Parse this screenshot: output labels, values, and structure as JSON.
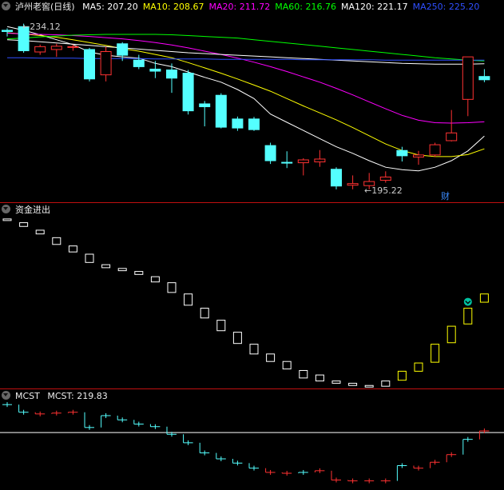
{
  "price_panel": {
    "stock_title": "泸州老窖(日线)",
    "ma_labels": [
      {
        "text": "MA5: 207.20",
        "color": "#ffffff"
      },
      {
        "text": "MA10: 208.67",
        "color": "#ffff00"
      },
      {
        "text": "MA20: 211.72",
        "color": "#ff00ff"
      },
      {
        "text": "MA60: 216.76",
        "color": "#00ff00"
      },
      {
        "text": "MA120: 221.17",
        "color": "#ffffff"
      },
      {
        "text": "MA250: 225.20",
        "color": "#2f4fff"
      }
    ],
    "high_marker": "234.12",
    "low_marker": "195.22",
    "event_badge": "财"
  },
  "fund_panel": {
    "title": "资金进出"
  },
  "mcst_panel": {
    "title": "MCST",
    "value_label": "MCST: 219.83"
  },
  "colors": {
    "up": "#ff3232",
    "down": "#54ffff",
    "separator": "#c01010"
  },
  "chart_data": [
    {
      "type": "candlestick",
      "title": "泸州老窖(日线)",
      "x": [
        1,
        2,
        3,
        4,
        5,
        6,
        7,
        8,
        9,
        10,
        11,
        12,
        13,
        14,
        15,
        16,
        17,
        18,
        19,
        20,
        21,
        22,
        23,
        24,
        25,
        26,
        27,
        28,
        29,
        30
      ],
      "ylim": [
        192,
        236
      ],
      "candles": [
        {
          "o": 232.5,
          "h": 233.0,
          "l": 231.0,
          "c": 232.2
        },
        {
          "o": 233.4,
          "h": 234.12,
          "l": 227.0,
          "c": 227.5
        },
        {
          "o": 227.2,
          "h": 229.0,
          "l": 226.5,
          "c": 228.5
        },
        {
          "o": 227.8,
          "h": 229.2,
          "l": 226.0,
          "c": 228.6
        },
        {
          "o": 228.4,
          "h": 229.0,
          "l": 227.5,
          "c": 228.5
        },
        {
          "o": 227.8,
          "h": 228.2,
          "l": 220.0,
          "c": 220.6
        },
        {
          "o": 221.6,
          "h": 228.5,
          "l": 220.0,
          "c": 227.3
        },
        {
          "o": 229.2,
          "h": 229.6,
          "l": 225.0,
          "c": 226.4
        },
        {
          "o": 225.2,
          "h": 226.5,
          "l": 223.0,
          "c": 223.6
        },
        {
          "o": 223.0,
          "h": 225.0,
          "l": 220.8,
          "c": 222.5
        },
        {
          "o": 222.8,
          "h": 224.4,
          "l": 217.2,
          "c": 220.8
        },
        {
          "o": 222.0,
          "h": 222.8,
          "l": 211.9,
          "c": 212.8
        },
        {
          "o": 214.5,
          "h": 215.2,
          "l": 209.0,
          "c": 213.8
        },
        {
          "o": 216.6,
          "h": 217.1,
          "l": 208.5,
          "c": 208.8
        },
        {
          "o": 210.8,
          "h": 211.4,
          "l": 207.9,
          "c": 208.6
        },
        {
          "o": 210.8,
          "h": 211.3,
          "l": 207.9,
          "c": 208.2
        },
        {
          "o": 204.3,
          "h": 205.0,
          "l": 199.8,
          "c": 200.6
        },
        {
          "o": 200.2,
          "h": 202.9,
          "l": 198.8,
          "c": 200.0
        },
        {
          "o": 200.1,
          "h": 201.2,
          "l": 197.0,
          "c": 200.8
        },
        {
          "o": 200.3,
          "h": 203.2,
          "l": 199.1,
          "c": 201.0
        },
        {
          "o": 198.5,
          "h": 199.0,
          "l": 193.6,
          "c": 194.4
        },
        {
          "o": 194.6,
          "h": 197.0,
          "l": 193.6,
          "c": 195.0
        },
        {
          "o": 194.5,
          "h": 197.6,
          "l": 193.6,
          "c": 195.5
        },
        {
          "o": 195.8,
          "h": 198.0,
          "l": 195.22,
          "c": 196.6
        },
        {
          "o": 203.1,
          "h": 204.0,
          "l": 200.4,
          "c": 201.8
        },
        {
          "o": 201.5,
          "h": 203.0,
          "l": 199.6,
          "c": 202.0
        },
        {
          "o": 202.0,
          "h": 205.0,
          "l": 201.5,
          "c": 204.5
        },
        {
          "o": 205.5,
          "h": 213.0,
          "l": 205.3,
          "c": 207.4
        },
        {
          "o": 215.6,
          "h": 226.0,
          "l": 211.5,
          "c": 226.0
        },
        {
          "o": 221.2,
          "h": 223.0,
          "l": 219.8,
          "c": 220.4
        }
      ],
      "ma": [
        {
          "name": "MA5",
          "color": "#ffffff",
          "values": [
            233.4,
            232.5,
            231.4,
            230.2,
            229.0,
            227.2,
            226.4,
            226.0,
            225.7,
            224.4,
            223.6,
            222.3,
            221.0,
            219.8,
            218.0,
            215.8,
            212.0,
            210.0,
            208.0,
            206.0,
            204.0,
            202.4,
            200.6,
            199.0,
            198.4,
            198.1,
            199.0,
            200.6,
            203.0,
            206.6
          ]
        },
        {
          "name": "MA10",
          "color": "#ffff00",
          "values": [
            231.9,
            231.6,
            231.2,
            230.8,
            230.2,
            229.5,
            228.8,
            228.0,
            227.4,
            226.6,
            225.8,
            224.6,
            223.3,
            222.0,
            220.6,
            219.1,
            217.6,
            215.8,
            214.0,
            212.3,
            210.6,
            208.7,
            206.7,
            204.7,
            203.1,
            202.0,
            201.6,
            201.6,
            202.1,
            203.5
          ]
        },
        {
          "name": "MA20",
          "color": "#ff00ff",
          "values": [
            231.8,
            231.6,
            231.5,
            231.4,
            231.2,
            231.0,
            230.7,
            230.4,
            230.0,
            229.5,
            228.9,
            228.2,
            227.4,
            226.6,
            225.7,
            224.7,
            223.6,
            222.4,
            221.1,
            219.8,
            218.3,
            216.7,
            215.0,
            213.3,
            211.7,
            210.5,
            209.9,
            209.8,
            209.9,
            210.1
          ]
        },
        {
          "name": "MA60",
          "color": "#00ff00",
          "values": [
            230.4,
            230.6,
            230.9,
            231.1,
            231.3,
            231.4,
            231.5,
            231.5,
            231.5,
            231.5,
            231.4,
            231.2,
            231.0,
            230.8,
            230.6,
            230.2,
            229.8,
            229.4,
            229.0,
            228.6,
            228.2,
            227.8,
            227.4,
            227.0,
            226.6,
            226.2,
            225.8,
            225.5,
            225.2,
            225.0
          ]
        },
        {
          "name": "MA120",
          "color": "#ffffff",
          "values": [
            230.2,
            230.0,
            229.7,
            229.4,
            229.1,
            228.8,
            228.5,
            228.2,
            227.9,
            227.6,
            227.3,
            227.0,
            226.8,
            226.6,
            226.4,
            226.2,
            226.0,
            225.8,
            225.6,
            225.4,
            225.2,
            225.0,
            224.8,
            224.6,
            224.4,
            224.3,
            224.2,
            224.2,
            224.2,
            224.3
          ]
        },
        {
          "name": "MA250",
          "color": "#2f4fff",
          "values": [
            225.8,
            225.8,
            225.7,
            225.7,
            225.7,
            225.6,
            225.6,
            225.6,
            225.6,
            225.5,
            225.5,
            225.5,
            225.5,
            225.4,
            225.4,
            225.4,
            225.4,
            225.4,
            225.3,
            225.3,
            225.3,
            225.3,
            225.3,
            225.2,
            225.2,
            225.2,
            225.2,
            225.2,
            225.2,
            225.2
          ]
        }
      ]
    },
    {
      "type": "bar",
      "title": "资金进出",
      "x": [
        1,
        2,
        3,
        4,
        5,
        6,
        7,
        8,
        9,
        10,
        11,
        12,
        13,
        14,
        15,
        16,
        17,
        18,
        19,
        20,
        21,
        22,
        23,
        24,
        25,
        26,
        27,
        28,
        29,
        30
      ],
      "ylim": [
        0,
        100
      ],
      "bars": [
        {
          "o": 99.0,
          "c": 98.0
        },
        {
          "o": 96.5,
          "c": 94.0
        },
        {
          "o": 91.5,
          "c": 89.0
        },
        {
          "o": 86.5,
          "c": 82.0
        },
        {
          "o": 81.0,
          "c": 77.0
        },
        {
          "o": 75.5,
          "c": 70.0
        },
        {
          "o": 68.5,
          "c": 66.5
        },
        {
          "o": 66.0,
          "c": 64.5
        },
        {
          "o": 64.0,
          "c": 62.0
        },
        {
          "o": 60.5,
          "c": 57.0
        },
        {
          "o": 56.5,
          "c": 50.0
        },
        {
          "o": 49.0,
          "c": 41.5
        },
        {
          "o": 39.5,
          "c": 33.0
        },
        {
          "o": 31.5,
          "c": 24.5
        },
        {
          "o": 23.5,
          "c": 16.0
        },
        {
          "o": 15.5,
          "c": 9.0
        },
        {
          "o": 9.0,
          "c": 4.0
        },
        {
          "o": 4.0,
          "c": -1.0
        },
        {
          "o": -2.0,
          "c": -7.0
        },
        {
          "o": -5.0,
          "c": -9.0
        },
        {
          "o": -9.0,
          "c": -10.5
        },
        {
          "o": -10.5,
          "c": -12.0
        },
        {
          "o": -12.0,
          "c": -13.0
        },
        {
          "o": -12.5,
          "c": -9.0
        },
        {
          "o": -8.5,
          "c": -2.5
        },
        {
          "o": -2.5,
          "c": 3.0
        },
        {
          "o": 3.5,
          "c": 15.5
        },
        {
          "o": 16.5,
          "c": 27.5
        },
        {
          "o": 29.0,
          "c": 39.5
        },
        {
          "o": 43.5,
          "c": 49.0
        }
      ]
    },
    {
      "type": "step",
      "title": "MCST",
      "series": [
        {
          "name": "MCST",
          "values": [
            219.83
          ]
        }
      ],
      "x": [
        1,
        2,
        3,
        4,
        5,
        6,
        7,
        8,
        9,
        10,
        11,
        12,
        13,
        14,
        15,
        16,
        17,
        18,
        19,
        20,
        21,
        22,
        23,
        24,
        25,
        26,
        27,
        28,
        29,
        30
      ],
      "ylim": [
        0,
        100
      ],
      "steps": [
        {
          "y": 97,
          "dir": "down"
        },
        {
          "y": 88,
          "dir": "down"
        },
        {
          "y": 86,
          "dir": "up"
        },
        {
          "y": 87,
          "dir": "up"
        },
        {
          "y": 88,
          "dir": "up"
        },
        {
          "y": 70,
          "dir": "down"
        },
        {
          "y": 84,
          "dir": "down"
        },
        {
          "y": 79,
          "dir": "down"
        },
        {
          "y": 74,
          "dir": "down"
        },
        {
          "y": 71,
          "dir": "down"
        },
        {
          "y": 62,
          "dir": "down"
        },
        {
          "y": 52,
          "dir": "down"
        },
        {
          "y": 40,
          "dir": "down"
        },
        {
          "y": 33,
          "dir": "down"
        },
        {
          "y": 28,
          "dir": "down"
        },
        {
          "y": 22,
          "dir": "down"
        },
        {
          "y": 17,
          "dir": "up"
        },
        {
          "y": 16,
          "dir": "up"
        },
        {
          "y": 17,
          "dir": "down"
        },
        {
          "y": 19,
          "dir": "up"
        },
        {
          "y": 8,
          "dir": "up"
        },
        {
          "y": 7,
          "dir": "up"
        },
        {
          "y": 7,
          "dir": "up"
        },
        {
          "y": 7,
          "dir": "up"
        },
        {
          "y": 25,
          "dir": "down"
        },
        {
          "y": 22,
          "dir": "up"
        },
        {
          "y": 29,
          "dir": "up"
        },
        {
          "y": 38,
          "dir": "up"
        },
        {
          "y": 56,
          "dir": "down"
        },
        {
          "y": 66,
          "dir": "up"
        }
      ],
      "reference_line": 64
    }
  ]
}
